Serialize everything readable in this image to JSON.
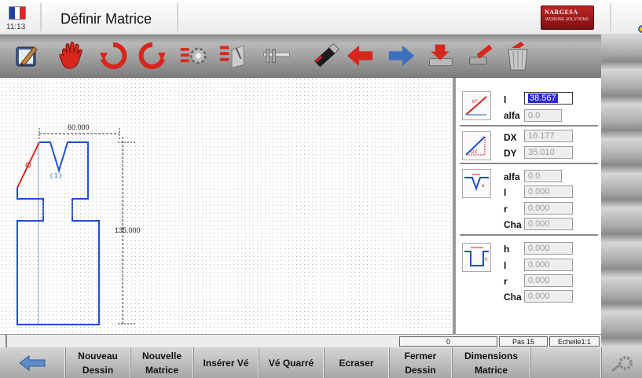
{
  "header": {
    "time": "11:13",
    "title": "Définir Matrice",
    "brand_name": "NARGESA",
    "brand_tag": "WORKING SOLUTIONS",
    "flag_colors": [
      "#1c3fa8",
      "#ffffff",
      "#d62828"
    ]
  },
  "toolbar": {
    "icons": [
      "edit-icon",
      "hand-icon",
      "rotate-left-icon",
      "rotate-right-icon",
      "generate-icon",
      "select-icon",
      "caliper-icon",
      "usb-icon",
      "back-arrow-icon",
      "forward-arrow-icon",
      "save-icon",
      "load-icon",
      "delete-icon"
    ]
  },
  "drawing": {
    "dim_width": "60.000",
    "dim_height": "135.000",
    "point_label": "( 1 )"
  },
  "params": {
    "seg1": {
      "l_label": "l",
      "l_value": "38.567",
      "alfa_label": "alfa",
      "alfa_value": "0.0"
    },
    "seg2": {
      "dx_label": "DX",
      "dx_value": "16.177",
      "dy_label": "DY",
      "dy_value": "35.010",
      "pic_label": "DX"
    },
    "seg3": {
      "alfa_label": "alfa",
      "alfa_value": "0.0",
      "l_label": "l",
      "l_value": "0.000",
      "r_label": "r",
      "r_value": "0.000",
      "cha_label": "Cha",
      "cha_value": "0.000"
    },
    "seg4": {
      "h_label": "h",
      "h_value": "0.000",
      "l_label": "l",
      "l_value": "0.000",
      "r_label": "r",
      "r_value": "0.000",
      "cha_label": "Cha",
      "cha_value": "0.000"
    }
  },
  "status": {
    "coord": "0",
    "pas": "Pas 15",
    "echelle": "Echelle1:1"
  },
  "bottom_buttons": [
    {
      "line1": "Nouveau",
      "line2": "Dessin"
    },
    {
      "line1": "Nouvelle",
      "line2": "Matrice"
    },
    {
      "line1": "Insérer Vé",
      "line2": ""
    },
    {
      "line1": "Vé Quarré",
      "line2": ""
    },
    {
      "line1": "Ecraser",
      "line2": ""
    },
    {
      "line1": "Fermer",
      "line2": "Dessin"
    },
    {
      "line1": "Dimensions",
      "line2": "Matrice"
    }
  ],
  "colors": {
    "accent_red": "#d8261c",
    "accent_blue": "#1f4ed1",
    "nav_blue": "#3e6fbe"
  }
}
